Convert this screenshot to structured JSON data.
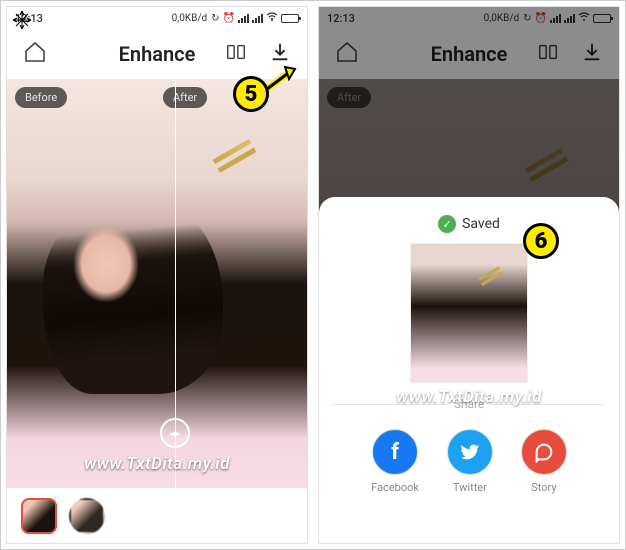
{
  "statusBar": {
    "time": "12:13",
    "dataRate": "0,0KB/d"
  },
  "header": {
    "title": "Enhance"
  },
  "viewer": {
    "beforeLabel": "Before",
    "afterLabel": "After",
    "watermark": "www.TxtDita.my.id"
  },
  "sheet": {
    "savedLabel": "Saved",
    "shareLabel": "Share",
    "shareItems": [
      {
        "name": "Facebook"
      },
      {
        "name": "Twitter"
      },
      {
        "name": "Story"
      }
    ]
  },
  "annotations": {
    "step5": "5",
    "step6": "6"
  }
}
